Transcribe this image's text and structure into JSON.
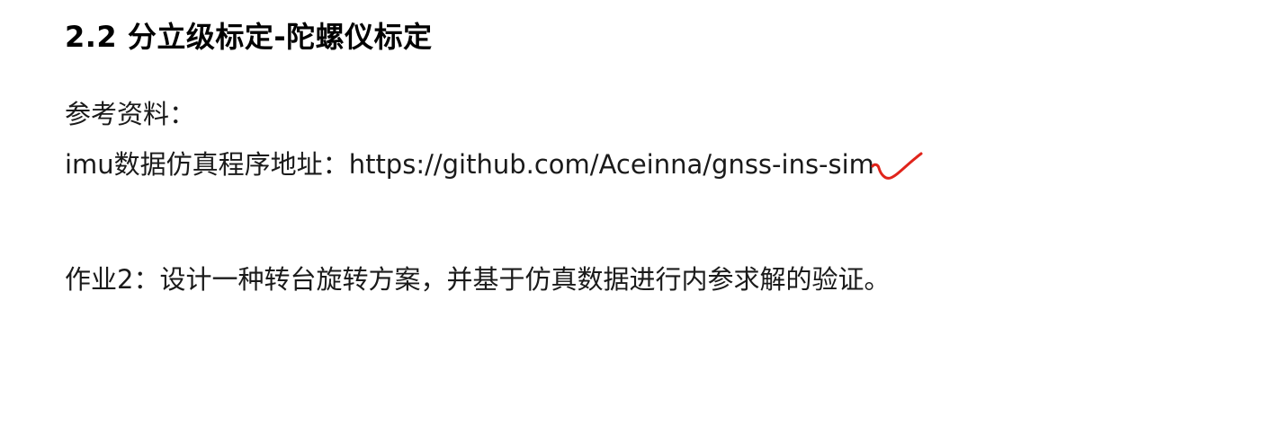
{
  "slide": {
    "title": "2.2 分立级标定-陀螺仪标定",
    "reference_label": "参考资料：",
    "sim_prefix": "imu数据仿真程序地址：",
    "sim_url": "https://github.com/Aceinna/gnss-ins-sim",
    "homework": "作业2：设计一种转台旋转方案，并基于仿真数据进行内参求解的验证。",
    "annotation_color": "#e0241b"
  }
}
